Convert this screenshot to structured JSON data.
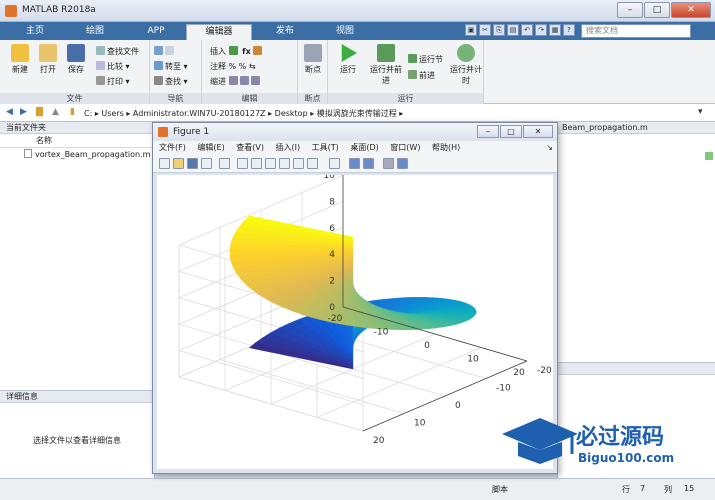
{
  "window": {
    "title": "MATLAB R2018a"
  },
  "tabs": [
    "主页",
    "绘图",
    "APP",
    "编辑器",
    "发布",
    "视图"
  ],
  "active_tab": 3,
  "search": {
    "placeholder": "搜索文档"
  },
  "ribbon": {
    "file_group": {
      "label": "文件",
      "new": "新建",
      "open": "打开",
      "save": "保存",
      "find_files": "查找文件",
      "compare": "比较",
      "print": "打印"
    },
    "nav_group": {
      "label": "导航",
      "goto": "转至",
      "find": "查找"
    },
    "edit_group": {
      "label": "编辑",
      "insert": "插入",
      "comment": "注释",
      "indent": "缩进"
    },
    "breakpoint_group": {
      "label": "断点",
      "breakpoints": "断点"
    },
    "run_group": {
      "label": "运行",
      "run": "运行",
      "run_advance": "运行并前进",
      "run_section": "运行节",
      "advance": "前进",
      "run_time": "运行并计时"
    }
  },
  "address": {
    "parts": [
      "C:",
      "Users",
      "Administrator.WIN7U-20180127Z",
      "Desktop",
      "模拟涡旋光束传输过程"
    ]
  },
  "current_folder": {
    "title": "当前文件夹",
    "col_name": "名称",
    "files": [
      "vortex_Beam_propagation.m"
    ]
  },
  "details": {
    "title": "详细信息",
    "empty_text": "选择文件以查看详细信息"
  },
  "editor_tab": {
    "name": "Beam_propagation.m"
  },
  "status": {
    "mode": "脚本",
    "row_label": "行",
    "row": "7",
    "col_label": "列",
    "col": "15"
  },
  "figure": {
    "title": "Figure 1",
    "menu": [
      "文件(F)",
      "编辑(E)",
      "查看(V)",
      "插入(I)",
      "工具(T)",
      "桌面(D)",
      "窗口(W)",
      "帮助(H)"
    ]
  },
  "chart_data": {
    "type": "surface",
    "title": "",
    "xlabel": "",
    "ylabel": "",
    "zlabel": "",
    "x_ticks": [
      "-20",
      "-10",
      "0",
      "10",
      "20"
    ],
    "y_ticks": [
      "-20",
      "-10",
      "0",
      "10",
      "20"
    ],
    "z_ticks": [
      "0",
      "2",
      "4",
      "6",
      "8",
      "10"
    ],
    "xlim": [
      -20,
      20
    ],
    "ylim": [
      -20,
      20
    ],
    "zlim": [
      0,
      10
    ],
    "grid": true,
    "colormap": "parula",
    "surface": "helicoid spiral, z increases with angle from 0 to 10"
  },
  "watermark": {
    "cn": "必过源码",
    "en": "Biguo100.com"
  },
  "colors": {
    "accent": "#3a6ea5",
    "tab_bg": "#3a6ea5",
    "ribbon_bg": "#f2f3f5"
  }
}
